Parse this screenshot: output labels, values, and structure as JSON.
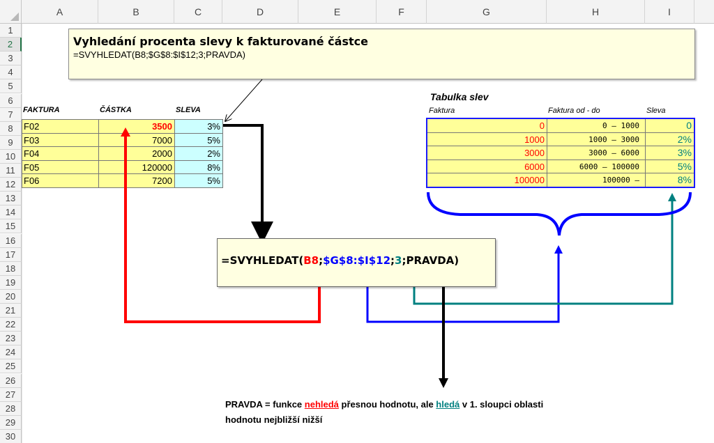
{
  "columns": [
    "A",
    "B",
    "C",
    "D",
    "E",
    "F",
    "G",
    "H",
    "I"
  ],
  "rows": [
    "1",
    "2",
    "3",
    "4",
    "5",
    "6",
    "7",
    "8",
    "9",
    "10",
    "11",
    "12",
    "13",
    "14",
    "15",
    "16",
    "17",
    "18",
    "19",
    "20",
    "21",
    "22",
    "23",
    "24",
    "25",
    "26",
    "27",
    "28",
    "29",
    "30"
  ],
  "active_row": "2",
  "note": {
    "title": "Vyhledání procenta slevy k fakturované částce",
    "formula": "=SVYHLEDAT(B8;$G$8:$I$12;3;PRAVDA)"
  },
  "left_table": {
    "headers": [
      "FAKTURA",
      "ČÁSTKA",
      "SLEVA"
    ],
    "rows": [
      {
        "faktura": "F02",
        "castka": "3500",
        "sleva": "3%"
      },
      {
        "faktura": "F03",
        "castka": "7000",
        "sleva": "5%"
      },
      {
        "faktura": "F04",
        "castka": "2000",
        "sleva": "2%"
      },
      {
        "faktura": "F05",
        "castka": "120000",
        "sleva": "8%"
      },
      {
        "faktura": "F06",
        "castka": "7200",
        "sleva": "5%"
      }
    ]
  },
  "discount_table": {
    "title": "Tabulka slev",
    "headers": [
      "Faktura",
      "Faktura od - do",
      "Sleva"
    ],
    "rows": [
      {
        "faktura": "0",
        "range": "0 – 1000",
        "sleva": "0"
      },
      {
        "faktura": "1000",
        "range": "1000 – 3000",
        "sleva": "2%"
      },
      {
        "faktura": "3000",
        "range": "3000 – 6000",
        "sleva": "3%"
      },
      {
        "faktura": "6000",
        "range": "6000 – 100000",
        "sleva": "5%"
      },
      {
        "faktura": "100000",
        "range": "100000 –",
        "sleva": "8%"
      }
    ]
  },
  "formula_parts": {
    "p1": "=SVYHLEDAT(",
    "b8": "B8",
    "sep1": ";",
    "range": "$G$8:$I$12",
    "sep2": ";",
    "col": "3",
    "p2": ";PRAVDA)"
  },
  "explanation": {
    "part1": "PRAVDA = funkce ",
    "nehleda": "nehledá",
    "part2": " přesnou hodnotu, ale ",
    "hleda": "hledá",
    "part3": " v 1. sloupci oblasti",
    "line2": "hodnotu nejbližší nižší"
  },
  "colors": {
    "red": "#ff0000",
    "blue": "#0000ff",
    "teal": "#008080",
    "yellow_cell": "#ffff99",
    "cyan_cell": "#ccffff",
    "excel_green": "#217346"
  }
}
